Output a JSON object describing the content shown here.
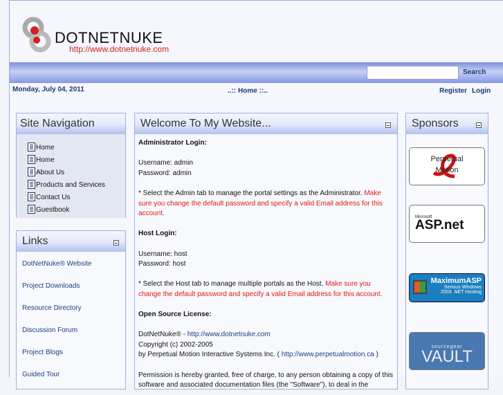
{
  "header": {
    "logo_text": "DOTNETNUKE",
    "logo_url": "http://www.dotnetnuke.com",
    "search_button": "Search",
    "search_value": ""
  },
  "topbar": {
    "date": "Monday, July 04, 2011",
    "breadcrumb": "..:: Home ::..",
    "register": "Register",
    "login": "Login"
  },
  "site_nav": {
    "title": "Site Navigation",
    "items": [
      "Home",
      "Home",
      "About Us",
      "Products and Services",
      "Contact Us",
      "Guestbook"
    ]
  },
  "links": {
    "title": "Links",
    "items": [
      "DotNetNuke® Website",
      "Project Downloads",
      "Resource Directory",
      "Discussion Forum",
      "Project Blogs",
      "Guided Tour"
    ]
  },
  "welcome": {
    "title": "Welcome To My Website...",
    "admin_heading": "Administrator Login:",
    "admin_user": "Username: admin",
    "admin_pass": "Password: admin",
    "admin_note": "* Select the Admin tab to manage the portal settings as the Administrator.",
    "admin_warning": "Make sure you change the default password and specify a valid Email address for this account.",
    "host_heading": "Host Login:",
    "host_user": "Username: host",
    "host_pass": "Password: host",
    "host_note": "* Select the Host tab to manage multiple portals as the Host.",
    "host_warning": "Make sure you change the default password and specify a valid Email address for this account.",
    "license_heading": "Open Source License:",
    "dnn_name": "DotNetNuke® - ",
    "dnn_link": "http://www.dotnetnuke.com",
    "copyright": "Copyright (c) 2002-2005",
    "by_text": "by Perpetual Motion Interactive Systems Inc. ( ",
    "pm_link": "http://www.perpetualmotion.ca",
    "by_close": " )",
    "permission": "Permission is hereby granted, free of charge, to any person obtaining a copy of this software and associated documentation files (the \"Software\"), to deal in the"
  },
  "sponsors": {
    "title": "Sponsors",
    "items": [
      {
        "name": "Perpetual Motion",
        "line1": "Perpetual",
        "line2": "Motion"
      },
      {
        "name": "ASP.net",
        "line1": "Microsoft",
        "line2": "ASP.net"
      },
      {
        "name": "MaximumASP",
        "line1": "MaximumASP",
        "line2": "Serious Windows",
        "line3": "2003 .NET Hosting"
      },
      {
        "name": "SourceGear Vault",
        "line1": "sourcegear",
        "line2": "VAULT"
      }
    ]
  }
}
